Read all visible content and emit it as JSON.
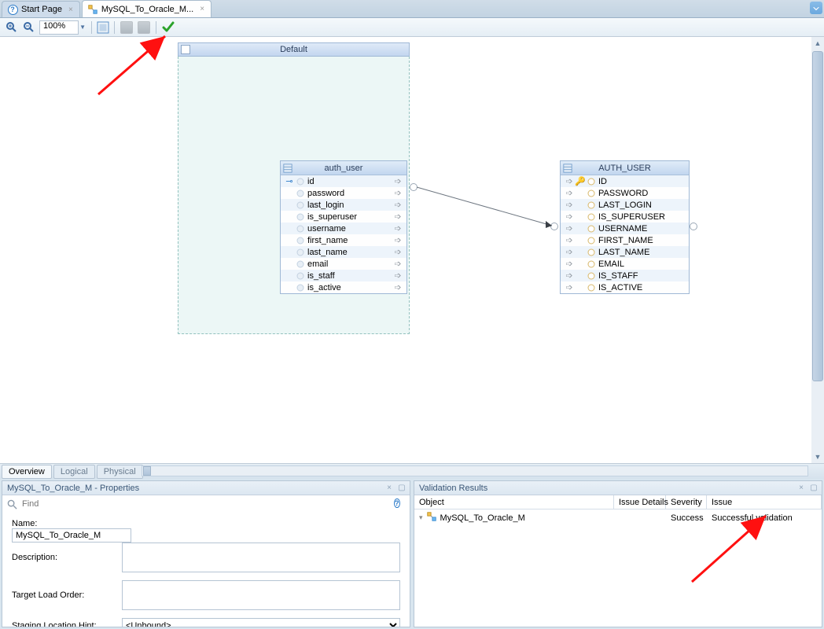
{
  "tabs": {
    "start_label": "Start Page",
    "mapping_label": "MySQL_To_Oracle_M..."
  },
  "toolbar": {
    "zoom_value": "100%"
  },
  "canvas": {
    "region_title": "Default",
    "source_table": {
      "name": "auth_user",
      "columns": [
        "id",
        "password",
        "last_login",
        "is_superuser",
        "username",
        "first_name",
        "last_name",
        "email",
        "is_staff",
        "is_active"
      ]
    },
    "target_table": {
      "name": "AUTH_USER",
      "columns": [
        "ID",
        "PASSWORD",
        "LAST_LOGIN",
        "IS_SUPERUSER",
        "USERNAME",
        "FIRST_NAME",
        "LAST_NAME",
        "EMAIL",
        "IS_STAFF",
        "IS_ACTIVE"
      ]
    }
  },
  "editor_tabs": {
    "overview": "Overview",
    "logical": "Logical",
    "physical": "Physical"
  },
  "props_panel": {
    "title": "MySQL_To_Oracle_M - Properties",
    "find_placeholder": "Find",
    "name_label": "Name:",
    "name_value": "MySQL_To_Oracle_M",
    "desc_label": "Description:",
    "tlo_label": "Target Load Order:",
    "slh_label": "Staging Location Hint:",
    "slh_value": "<Unbound>"
  },
  "validation_panel": {
    "title": "Validation Results",
    "cols": {
      "object": "Object",
      "details": "Issue Details",
      "severity": "Severity",
      "issue": "Issue"
    },
    "row": {
      "object": "MySQL_To_Oracle_M",
      "details": "",
      "severity": "Success",
      "issue": "Successful validation"
    }
  }
}
